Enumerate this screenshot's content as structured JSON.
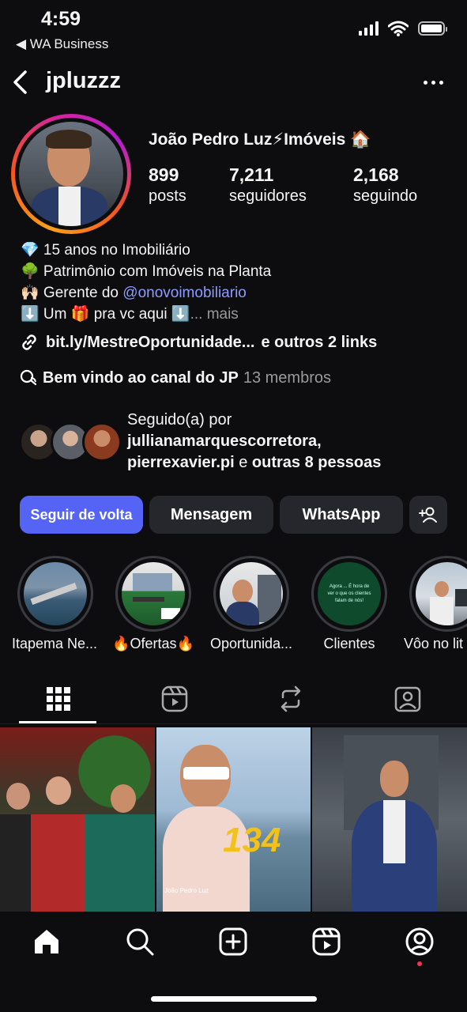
{
  "status_bar": {
    "time": "4:59",
    "back_app": "◀ WA Business"
  },
  "header": {
    "username": "jpluzzz"
  },
  "profile": {
    "display_name": "João Pedro Luz⚡Imóveis 🏠",
    "stats": [
      {
        "value": "899",
        "label": "posts"
      },
      {
        "value": "7,211",
        "label": "seguidores"
      },
      {
        "value": "2,168",
        "label": "seguindo"
      }
    ],
    "bio": {
      "line1": "💎 15 anos no Imobiliário",
      "line2": "🌳 Patrimônio com Imóveis na Planta",
      "line3_prefix": "🙌🏻 Gerente do ",
      "line3_mention": "@onovoimobiliario",
      "line4": "⬇️ Um 🎁 pra vc aqui ⬇️",
      "line4_more": "... mais"
    },
    "link": {
      "text": "bit.ly/MestreOportunidade...",
      "extra": " e outros 2 links"
    },
    "channel": {
      "name": "Bem vindo ao canal do JP",
      "members": "13 membros"
    },
    "followed_by": {
      "intro": "Seguido(a) por",
      "name1": "jullianamarquescorretora,",
      "name2": "pierrexavier.pi",
      "connector": " e ",
      "others": "outras 8 pessoas"
    }
  },
  "actions": {
    "follow_back": "Seguir de volta",
    "message": "Mensagem",
    "whatsapp": "WhatsApp"
  },
  "highlights": [
    {
      "label": "Itapema Ne..."
    },
    {
      "label": "🔥Ofertas🔥"
    },
    {
      "label": "Oportunida..."
    },
    {
      "label": "Clientes",
      "story_text": "Agora ... É hora de ver o que os clientes falam de nós!"
    },
    {
      "label": "Vôo no lit"
    }
  ],
  "grid": [
    {
      "caption": ""
    },
    {
      "caption": "134",
      "sub": "João Pedro Luz"
    },
    {
      "caption": ""
    }
  ]
}
